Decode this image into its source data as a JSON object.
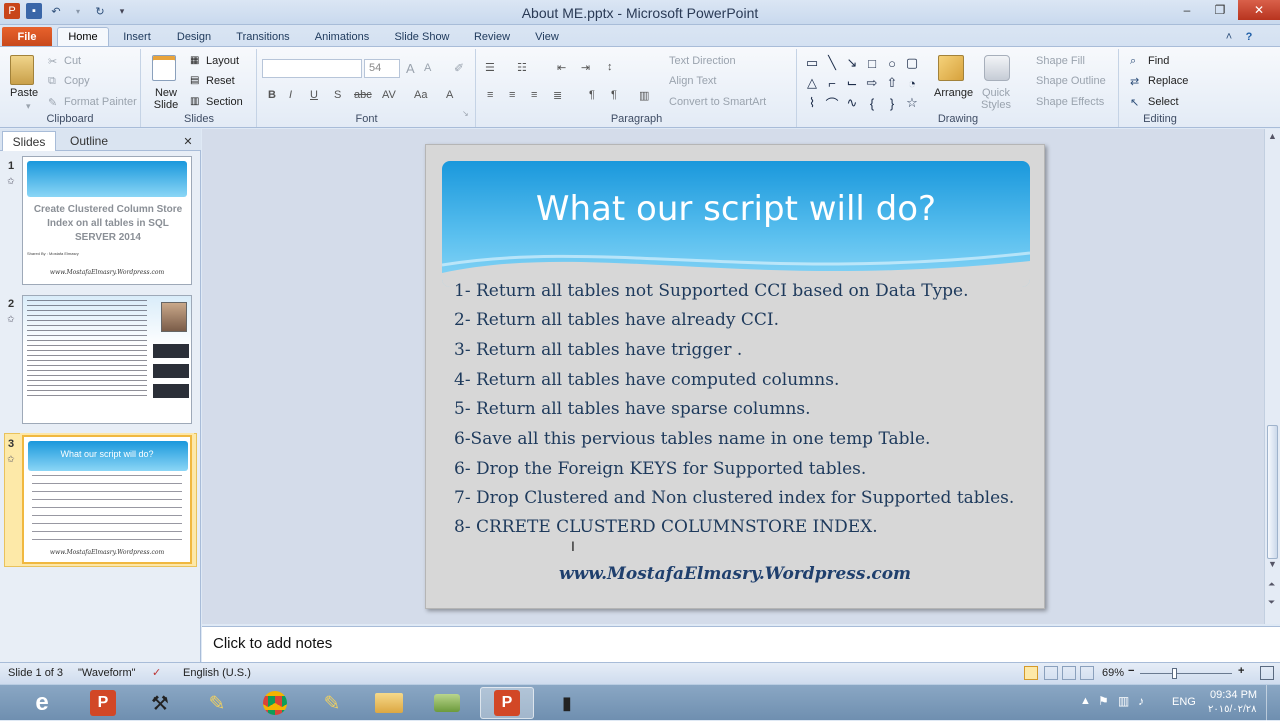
{
  "window": {
    "title": "About ME.pptx - Microsoft PowerPoint",
    "minimize": "–",
    "restore": "❐",
    "close": "✕"
  },
  "tabs": [
    "File",
    "Home",
    "Insert",
    "Design",
    "Transitions",
    "Animations",
    "Slide Show",
    "Review",
    "View"
  ],
  "ribbon": {
    "clipboard": {
      "label": "Clipboard",
      "paste": "Paste",
      "cut": "Cut",
      "copy": "Copy",
      "format_painter": "Format Painter"
    },
    "slides": {
      "label": "Slides",
      "new_slide": "New Slide",
      "layout": "Layout",
      "reset": "Reset",
      "section": "Section"
    },
    "font": {
      "label": "Font",
      "font_name": "",
      "font_size": "54"
    },
    "paragraph": {
      "label": "Paragraph",
      "text_direction": "Text Direction",
      "align_text": "Align Text",
      "convert_smartart": "Convert to SmartArt"
    },
    "drawing": {
      "label": "Drawing",
      "arrange": "Arrange",
      "quick_styles": "Quick Styles",
      "shape_fill": "Shape Fill",
      "shape_outline": "Shape Outline",
      "shape_effects": "Shape Effects"
    },
    "editing": {
      "label": "Editing",
      "find": "Find",
      "replace": "Replace",
      "select": "Select"
    }
  },
  "pane": {
    "tab_slides": "Slides",
    "tab_outline": "Outline",
    "close": "✕"
  },
  "thumbnails": [
    {
      "num": "1",
      "title": "Create Clustered Column Store Index on all tables in SQL SERVER 2014",
      "author": "Shared By : Mostafa Elmasry",
      "url": "www.MostafaElmasry.Wordpress.com"
    },
    {
      "num": "2"
    },
    {
      "num": "3",
      "title": "What our script will do?",
      "url": "www.MostafaElmasry.Wordpress.com"
    }
  ],
  "slide": {
    "title": "What our script will do?",
    "bullets": [
      "1- Return all tables not Supported CCI based on Data Type.",
      "2- Return all tables have already CCI.",
      "3- Return all tables have trigger .",
      "4- Return all tables have computed columns.",
      "5- Return all tables have sparse columns.",
      "6-Save all this pervious tables name in one temp Table.",
      "6- Drop the Foreign KEYS for Supported tables.",
      "7- Drop Clustered and Non clustered index for Supported tables.",
      "8- CRRETE CLUSTERD COLUMNSTORE INDEX."
    ],
    "url": "www.MostafaElmasry.Wordpress.com"
  },
  "notes": {
    "placeholder": "Click to add notes"
  },
  "status": {
    "slide_of": "Slide 1 of 3",
    "theme": "\"Waveform\"",
    "language": "English (U.S.)",
    "zoom": "69%"
  },
  "taskbar": {
    "lang": "ENG",
    "time": "09:34 PM",
    "date": "٢٠١٥/٠٢/٢٨"
  },
  "colors": {
    "file_tab": "#d4541f",
    "banner": "#1a98dc",
    "title_text": "#ffffff",
    "body_text": "#1e3a5c"
  }
}
